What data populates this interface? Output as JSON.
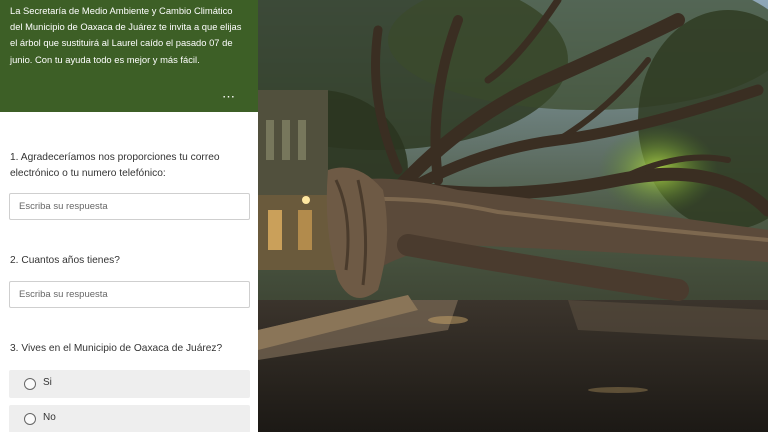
{
  "header": {
    "description": "La Secretaría de Medio Ambiente y Cambio Climático del Municipio de Oaxaca de Juárez te invita a que elijas el árbol que sustituirá al Laurel caído el pasado 07 de junio. Con tu ayuda todo es mejor y más fácil.",
    "more_icon": "⋯"
  },
  "questions": [
    {
      "number": "1.",
      "text": "Agradeceríamos nos proporciones tu correo electrónico o tu numero telefónico:",
      "placeholder": "Escriba su respuesta"
    },
    {
      "number": "2.",
      "text": "Cuantos años tienes?",
      "placeholder": "Escriba su respuesta"
    },
    {
      "number": "3.",
      "text": "Vives en el Municipio de Oaxaca de Juárez?",
      "options": [
        "Si",
        "No"
      ]
    }
  ],
  "colors": {
    "header_bg": "#3d5f26",
    "option_bg": "#eeeeee"
  },
  "photo": {
    "subject": "fallen-laurel-tree"
  }
}
